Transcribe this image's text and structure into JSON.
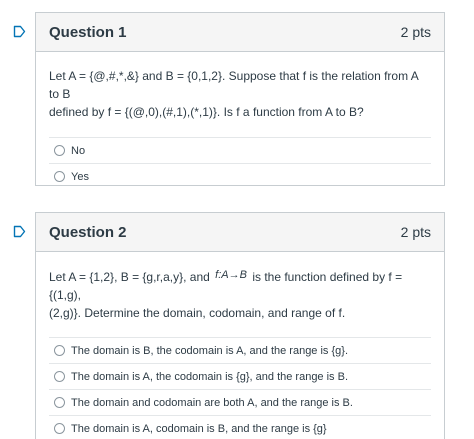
{
  "questions": [
    {
      "title": "Question 1",
      "points": "2 pts",
      "text_line1": "Let A = {@,#,*,&} and B = {0,1,2}.  Suppose that f is the relation from A to B",
      "text_line2": "defined by f = {(@,0),(#,1),(*,1)}.  Is f a function from A to B?",
      "answers": [
        "No",
        "Yes"
      ]
    },
    {
      "title": "Question 2",
      "points": "2 pts",
      "text_part1": "Let A = {1,2}, B = {g,r,a,y}, and",
      "math_f": "f",
      "math_colon": ":",
      "math_A": "A",
      "math_arrow": "→",
      "math_B": "B",
      "text_part2": "is the function defined by f = {(1,g),",
      "text_line2": "(2,g)}.  Determine the domain, codomain, and range of f.",
      "answers": [
        "The domain is B, the codomain is A, and the range is {g}.",
        "The domain is A, the codomain is {g}, and the range is B.",
        "The domain and codomain are both A, and the range is B.",
        "The domain is A, codomain is B, and the range is {g}"
      ]
    }
  ],
  "colors": {
    "accent_icon": "#0374b5",
    "header_bg": "#f5f5f5",
    "border": "#c7cdd1",
    "text": "#2d3b45"
  },
  "icons": [
    "question-flag-icon",
    "radio-unselected-icon"
  ]
}
